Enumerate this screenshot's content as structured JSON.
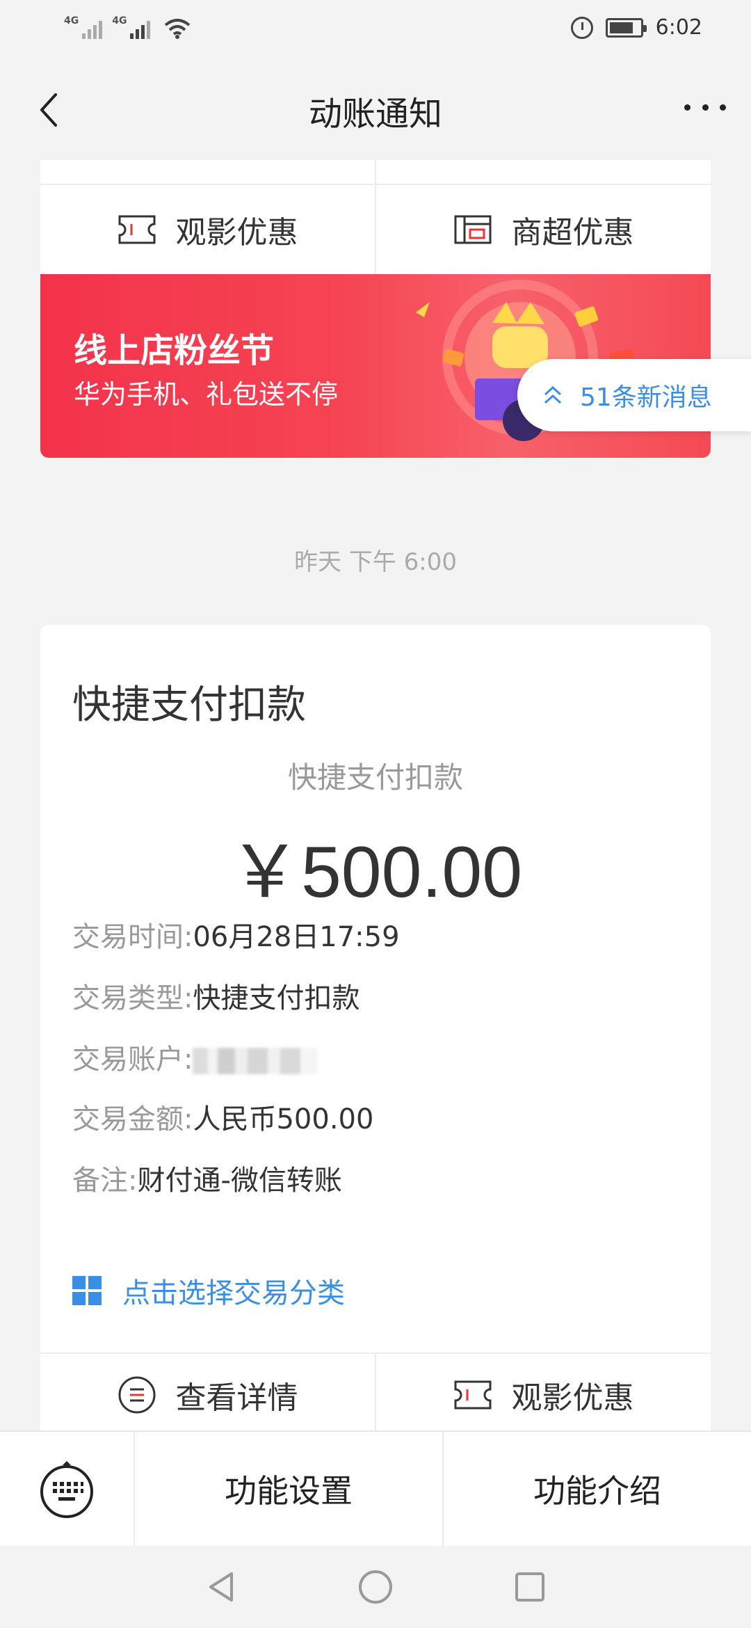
{
  "status_bar": {
    "sim1": "4G",
    "sim2": "4G",
    "time": "6:02"
  },
  "nav": {
    "title": "动账通知"
  },
  "top_card": {
    "actions": [
      {
        "label": "观影优惠",
        "icon": "ticket-icon"
      },
      {
        "label": "商超优惠",
        "icon": "store-icon"
      }
    ]
  },
  "banner": {
    "title": "线上店粉丝节",
    "subtitle": "华为手机、礼包送不停"
  },
  "new_messages": {
    "label": "51条新消息"
  },
  "timestamp": "昨天 下午 6:00",
  "message": {
    "title": "快捷支付扣款",
    "subtitle": "快捷支付扣款",
    "amount": "￥500.00",
    "details": [
      {
        "key": "交易时间:",
        "value": "06月28日17:59"
      },
      {
        "key": "交易类型:",
        "value": "快捷支付扣款"
      },
      {
        "key": "交易账户:",
        "value": ""
      },
      {
        "key": "交易金额:",
        "value": "人民币500.00"
      },
      {
        "key": "备注:",
        "value": "财付通-微信转账"
      }
    ],
    "category_link": "点击选择交易分类",
    "actions": [
      {
        "label": "查看详情",
        "icon": "list-icon"
      },
      {
        "label": "观影优惠",
        "icon": "ticket-icon"
      }
    ]
  },
  "toolbar": {
    "settings": "功能设置",
    "intro": "功能介绍"
  },
  "colors": {
    "accent_blue": "#3a8ee6",
    "banner_red": "#f3334b",
    "background": "#f3f3f3"
  }
}
